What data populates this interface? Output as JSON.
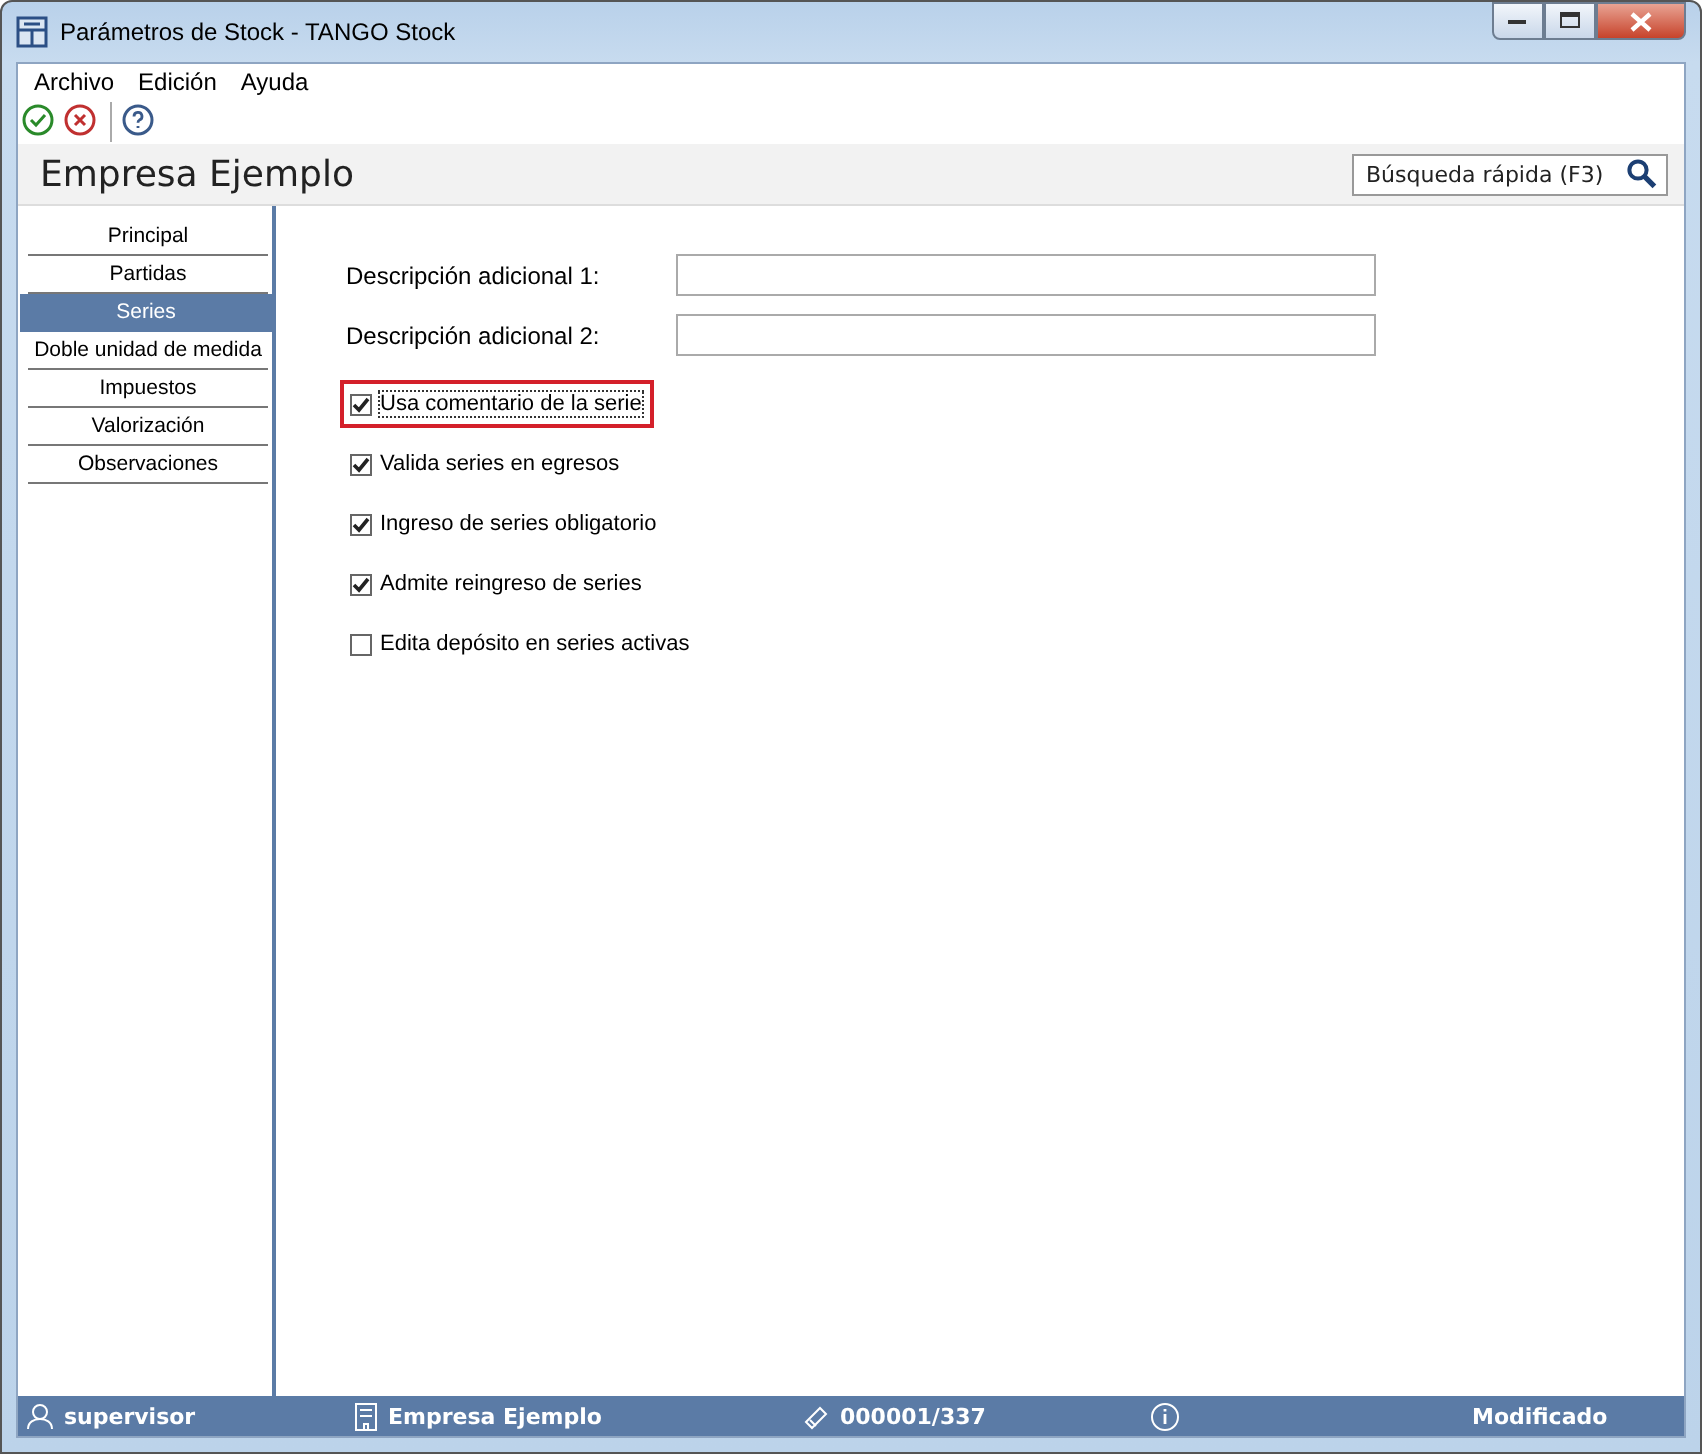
{
  "window": {
    "title": "Parámetros de Stock - TANGO Stock"
  },
  "menu": [
    {
      "label": "Archivo"
    },
    {
      "label": "Edición"
    },
    {
      "label": "Ayuda"
    }
  ],
  "toolbar": [
    {
      "kind": "accept"
    },
    {
      "kind": "cancel"
    },
    {
      "kind": "separator"
    },
    {
      "kind": "help"
    }
  ],
  "header": {
    "title": "Empresa Ejemplo",
    "search": {
      "placeholder": "Búsqueda rápida (F3)"
    }
  },
  "sidebar": {
    "items": [
      {
        "label": "Principal",
        "selected": false
      },
      {
        "label": "Partidas",
        "selected": false
      },
      {
        "label": "Series",
        "selected": true
      },
      {
        "label": "Doble unidad de medida",
        "selected": false
      },
      {
        "label": "Impuestos",
        "selected": false
      },
      {
        "label": "Valorización",
        "selected": false
      },
      {
        "label": "Observaciones",
        "selected": false
      }
    ]
  },
  "fields": [
    {
      "label": "Descripción adicional 1:"
    },
    {
      "label": "Descripción adicional 2:"
    }
  ],
  "checkboxes": [
    {
      "label": "Usa comentario de la serie",
      "checked": true,
      "focused": true,
      "highlighted": true
    },
    {
      "label": "Valida series en egresos",
      "checked": true,
      "focused": false,
      "highlighted": false
    },
    {
      "label": "Ingreso de series obligatorio",
      "checked": true,
      "focused": false,
      "highlighted": false
    },
    {
      "label": "Admite reingreso de series",
      "checked": true,
      "focused": false,
      "highlighted": false
    },
    {
      "label": "Edita depósito en series activas",
      "checked": false,
      "focused": false,
      "highlighted": false
    }
  ],
  "status_bar": [
    {
      "kind": "user",
      "text": "supervisor"
    },
    {
      "kind": "company",
      "text": "Empresa Ejemplo"
    },
    {
      "kind": "record",
      "text": "000001/337"
    },
    {
      "kind": "info"
    },
    {
      "kind": "state",
      "text": "Modificado"
    }
  ]
}
